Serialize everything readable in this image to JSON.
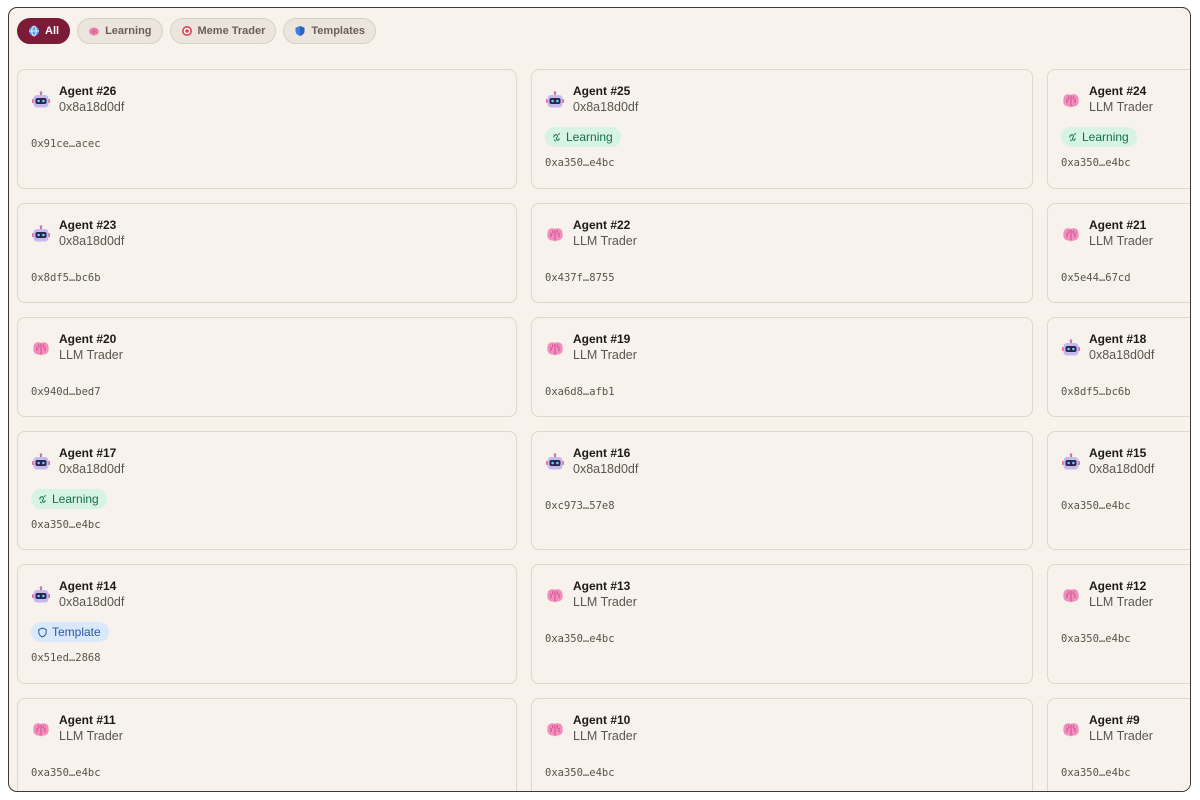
{
  "filters": [
    {
      "label": "All",
      "icon": "globe-icon",
      "active": true
    },
    {
      "label": "Learning",
      "icon": "brain-icon",
      "active": false
    },
    {
      "label": "Meme Trader",
      "icon": "target-icon",
      "active": false
    },
    {
      "label": "Templates",
      "icon": "shield-icon",
      "active": false
    }
  ],
  "agents": [
    {
      "name": "Agent #26",
      "subtitle": "0x8a18d0df",
      "avatar": "robot-icon",
      "badge": "",
      "address": "0x91ce…acec"
    },
    {
      "name": "Agent #25",
      "subtitle": "0x8a18d0df",
      "avatar": "robot-icon",
      "badge": "Learning",
      "address": "0xa350…e4bc"
    },
    {
      "name": "Agent #24",
      "subtitle": "LLM Trader",
      "avatar": "brain-icon",
      "badge": "Learning",
      "address": "0xa350…e4bc"
    },
    {
      "name": "Agent #23",
      "subtitle": "0x8a18d0df",
      "avatar": "robot-icon",
      "badge": "",
      "address": "0x8df5…bc6b"
    },
    {
      "name": "Agent #22",
      "subtitle": "LLM Trader",
      "avatar": "brain-icon",
      "badge": "",
      "address": "0x437f…8755"
    },
    {
      "name": "Agent #21",
      "subtitle": "LLM Trader",
      "avatar": "brain-icon",
      "badge": "",
      "address": "0x5e44…67cd"
    },
    {
      "name": "Agent #20",
      "subtitle": "LLM Trader",
      "avatar": "brain-icon",
      "badge": "",
      "address": "0x940d…bed7"
    },
    {
      "name": "Agent #19",
      "subtitle": "LLM Trader",
      "avatar": "brain-icon",
      "badge": "",
      "address": "0xa6d8…afb1"
    },
    {
      "name": "Agent #18",
      "subtitle": "0x8a18d0df",
      "avatar": "robot-icon",
      "badge": "",
      "address": "0x8df5…bc6b"
    },
    {
      "name": "Agent #17",
      "subtitle": "0x8a18d0df",
      "avatar": "robot-icon",
      "badge": "Learning",
      "address": "0xa350…e4bc"
    },
    {
      "name": "Agent #16",
      "subtitle": "0x8a18d0df",
      "avatar": "robot-icon",
      "badge": "",
      "address": "0xc973…57e8"
    },
    {
      "name": "Agent #15",
      "subtitle": "0x8a18d0df",
      "avatar": "robot-icon",
      "badge": "",
      "address": "0xa350…e4bc"
    },
    {
      "name": "Agent #14",
      "subtitle": "0x8a18d0df",
      "avatar": "robot-icon",
      "badge": "Template",
      "address": "0x51ed…2868"
    },
    {
      "name": "Agent #13",
      "subtitle": "LLM Trader",
      "avatar": "brain-icon",
      "badge": "",
      "address": "0xa350…e4bc"
    },
    {
      "name": "Agent #12",
      "subtitle": "LLM Trader",
      "avatar": "brain-icon",
      "badge": "",
      "address": "0xa350…e4bc"
    },
    {
      "name": "Agent #11",
      "subtitle": "LLM Trader",
      "avatar": "brain-icon",
      "badge": "",
      "address": "0xa350…e4bc"
    },
    {
      "name": "Agent #10",
      "subtitle": "LLM Trader",
      "avatar": "brain-icon",
      "badge": "",
      "address": "0xa350…e4bc"
    },
    {
      "name": "Agent #9",
      "subtitle": "LLM Trader",
      "avatar": "brain-icon",
      "badge": "",
      "address": "0xa350…e4bc"
    }
  ],
  "colors": {
    "active_chip": "#7c1b37",
    "learning_badge_bg": "#d6f3e4",
    "learning_badge_text": "#15704a",
    "template_badge_bg": "#d9e8fb",
    "template_badge_text": "#2a5aa5"
  }
}
